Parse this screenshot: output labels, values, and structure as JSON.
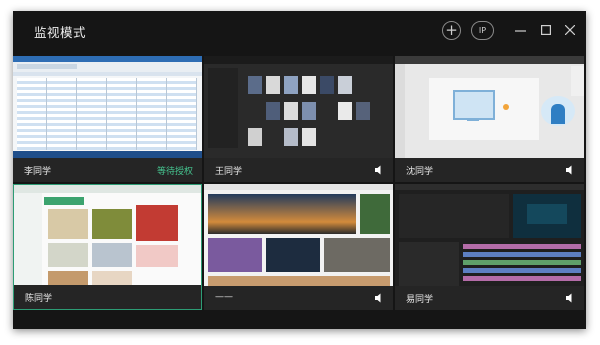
{
  "window": {
    "title": "监视模式",
    "ip_label": "IP"
  },
  "tiles": [
    {
      "name": "李同学",
      "status": "等待授权"
    },
    {
      "name": "王同学"
    },
    {
      "name": "沈同学"
    },
    {
      "name": "陈同学"
    },
    {
      "name": "——"
    },
    {
      "name": "易同学"
    }
  ]
}
